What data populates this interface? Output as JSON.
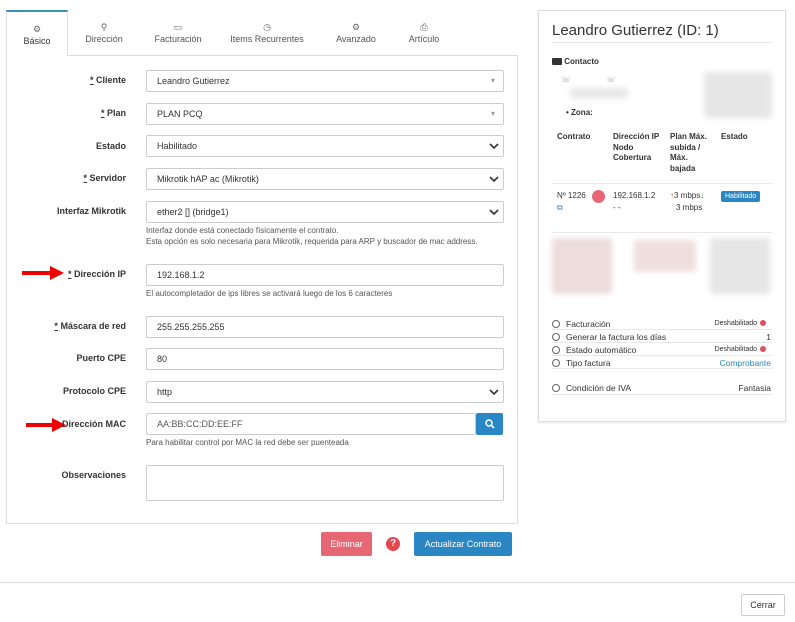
{
  "tabs": [
    {
      "label": "Básico",
      "icon": "gear-icon"
    },
    {
      "label": "Dirección",
      "icon": "map-pin-icon"
    },
    {
      "label": "Facturación",
      "icon": "money-icon"
    },
    {
      "label": "Items Recurrentes",
      "icon": "clock-icon"
    },
    {
      "label": "Avanzado",
      "icon": "cogs-icon"
    },
    {
      "label": "Artículo",
      "icon": "printer-icon"
    }
  ],
  "form": {
    "cliente": {
      "label": "Cliente",
      "value": "Leandro Gutierrez"
    },
    "plan": {
      "label": "Plan",
      "value": "PLAN PCQ"
    },
    "estado": {
      "label": "Estado",
      "value": "Habilitado"
    },
    "servidor": {
      "label": "Servidor",
      "value": "Mikrotik hAP ac (Mikrotik)"
    },
    "interfaz": {
      "label": "Interfaz Mikrotik",
      "value": "ether2 [] (bridge1)",
      "help1": "Interfaz donde está conectado físicamente el contrato.",
      "help2": "Esta opción es solo necesaria para Mikrotik, requerida para ARP y buscador de mac address."
    },
    "ip": {
      "label": "Dirección IP",
      "value": "192.168.1.2",
      "help": "El autocompletador de ips libres se activará luego de los 6 caracteres"
    },
    "mascara": {
      "label": "Máscara de red",
      "value": "255.255.255.255"
    },
    "puerto": {
      "label": "Puerto CPE",
      "value": "80"
    },
    "protocolo": {
      "label": "Protocolo CPE",
      "value": "http"
    },
    "mac": {
      "label": "Dirección MAC",
      "placeholder": "AA:BB:CC:DD:EE:FF",
      "help": "Para habilitar control por MAC la red debe ser puenteada"
    },
    "observaciones": {
      "label": "Observaciones",
      "value": ""
    },
    "req_star": "*"
  },
  "actions": {
    "delete": "Eliminar",
    "update": "Actualizar Contrato",
    "close": "Cerrar",
    "help_icon": "?"
  },
  "panel": {
    "title": "Leandro Gutierrez (ID: 1)",
    "contact_label": "Contacto",
    "zona_label": "Zona:",
    "columns": [
      "Contrato",
      "Dirección IP Nodo Cobertura",
      "Plan Máx. subida / Máx. bajada",
      "Estado"
    ],
    "row": {
      "contrato": "Nº 1226",
      "ip": "192.168.1.2",
      "nodo": "- -",
      "up": "3 mbps",
      "down": "3 mbps",
      "estado": "Habilitado"
    },
    "settings": [
      {
        "label": "Facturación",
        "value": "Deshabilitado",
        "dot": true
      },
      {
        "label": "Generar la factura los días",
        "value": "1",
        "dot": false
      },
      {
        "label": "Estado automático",
        "value": "Deshabilitado",
        "dot": true
      },
      {
        "label": "Tipo factura",
        "value": "Comprobante",
        "dot": false,
        "link": true
      },
      {
        "label": "Condición de IVA",
        "value": "Fantasia",
        "dot": false
      }
    ]
  },
  "colors": {
    "accent": "#3c8dbc",
    "danger": "#e66674",
    "primary": "#2a87c3",
    "arrow": "#e00000"
  }
}
